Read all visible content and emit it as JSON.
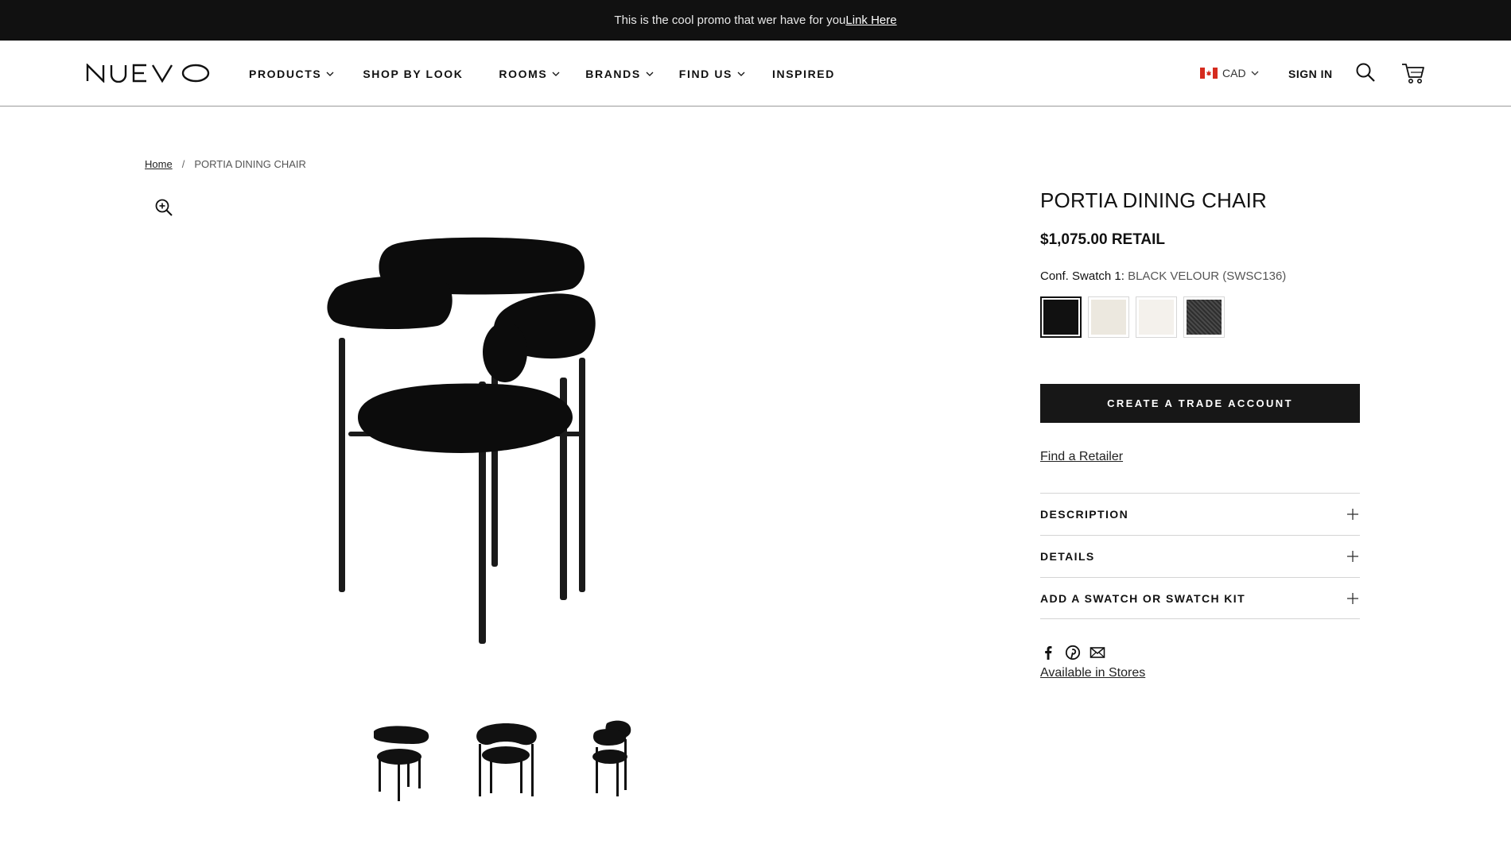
{
  "promo": {
    "text": "This is the cool promo that wer have for you",
    "link": "Link Here"
  },
  "header": {
    "logo": "NUEVO",
    "nav": [
      {
        "label": "PRODUCTS",
        "dropdown": true
      },
      {
        "label": "SHOP BY LOOK",
        "dropdown": false
      },
      {
        "label": "ROOMS",
        "dropdown": true
      },
      {
        "label": "BRANDS",
        "dropdown": true
      },
      {
        "label": "FIND US",
        "dropdown": true
      },
      {
        "label": "INSPIRED",
        "dropdown": false
      }
    ],
    "currency": "CAD",
    "sign_in": "SIGN IN",
    "icons": {
      "search": "search-icon",
      "cart": "cart-icon",
      "flag": "canada-flag-icon"
    }
  },
  "breadcrumb": {
    "home": "Home",
    "separator": "/",
    "current": "PORTIA DINING CHAIR"
  },
  "gallery": {
    "zoom_icon": "zoom-in-icon",
    "main_image": "chair-front-view",
    "thumbnails": [
      "chair-angle-thumb",
      "chair-front-thumb",
      "chair-side-thumb"
    ]
  },
  "product": {
    "title": "PORTIA DINING CHAIR",
    "price": "$1,075.00",
    "price_suffix": "RETAIL",
    "swatch_label": "Conf. Swatch 1:",
    "swatch_value": "BLACK VELOUR (SWSC136)",
    "swatches": [
      {
        "name": "black-velour",
        "color": "#111111",
        "selected": true
      },
      {
        "name": "cream",
        "color": "#ece8df",
        "selected": false
      },
      {
        "name": "white",
        "color": "#f4f1ec",
        "selected": false
      },
      {
        "name": "charcoal-boucle",
        "color": "#3a3a3a",
        "selected": false
      }
    ],
    "cta": "CREATE A TRADE ACCOUNT",
    "find_retailer": "Find a Retailer",
    "accordion": [
      "DESCRIPTION",
      "DETAILS",
      "ADD A SWATCH OR SWATCH KIT"
    ],
    "share_icons": [
      "facebook-icon",
      "pinterest-icon",
      "email-icon"
    ],
    "available": "Available in Stores"
  },
  "colors": {
    "promo_bg": "#111111",
    "cta_bg": "#171717",
    "flag_red": "#d52b1e"
  }
}
